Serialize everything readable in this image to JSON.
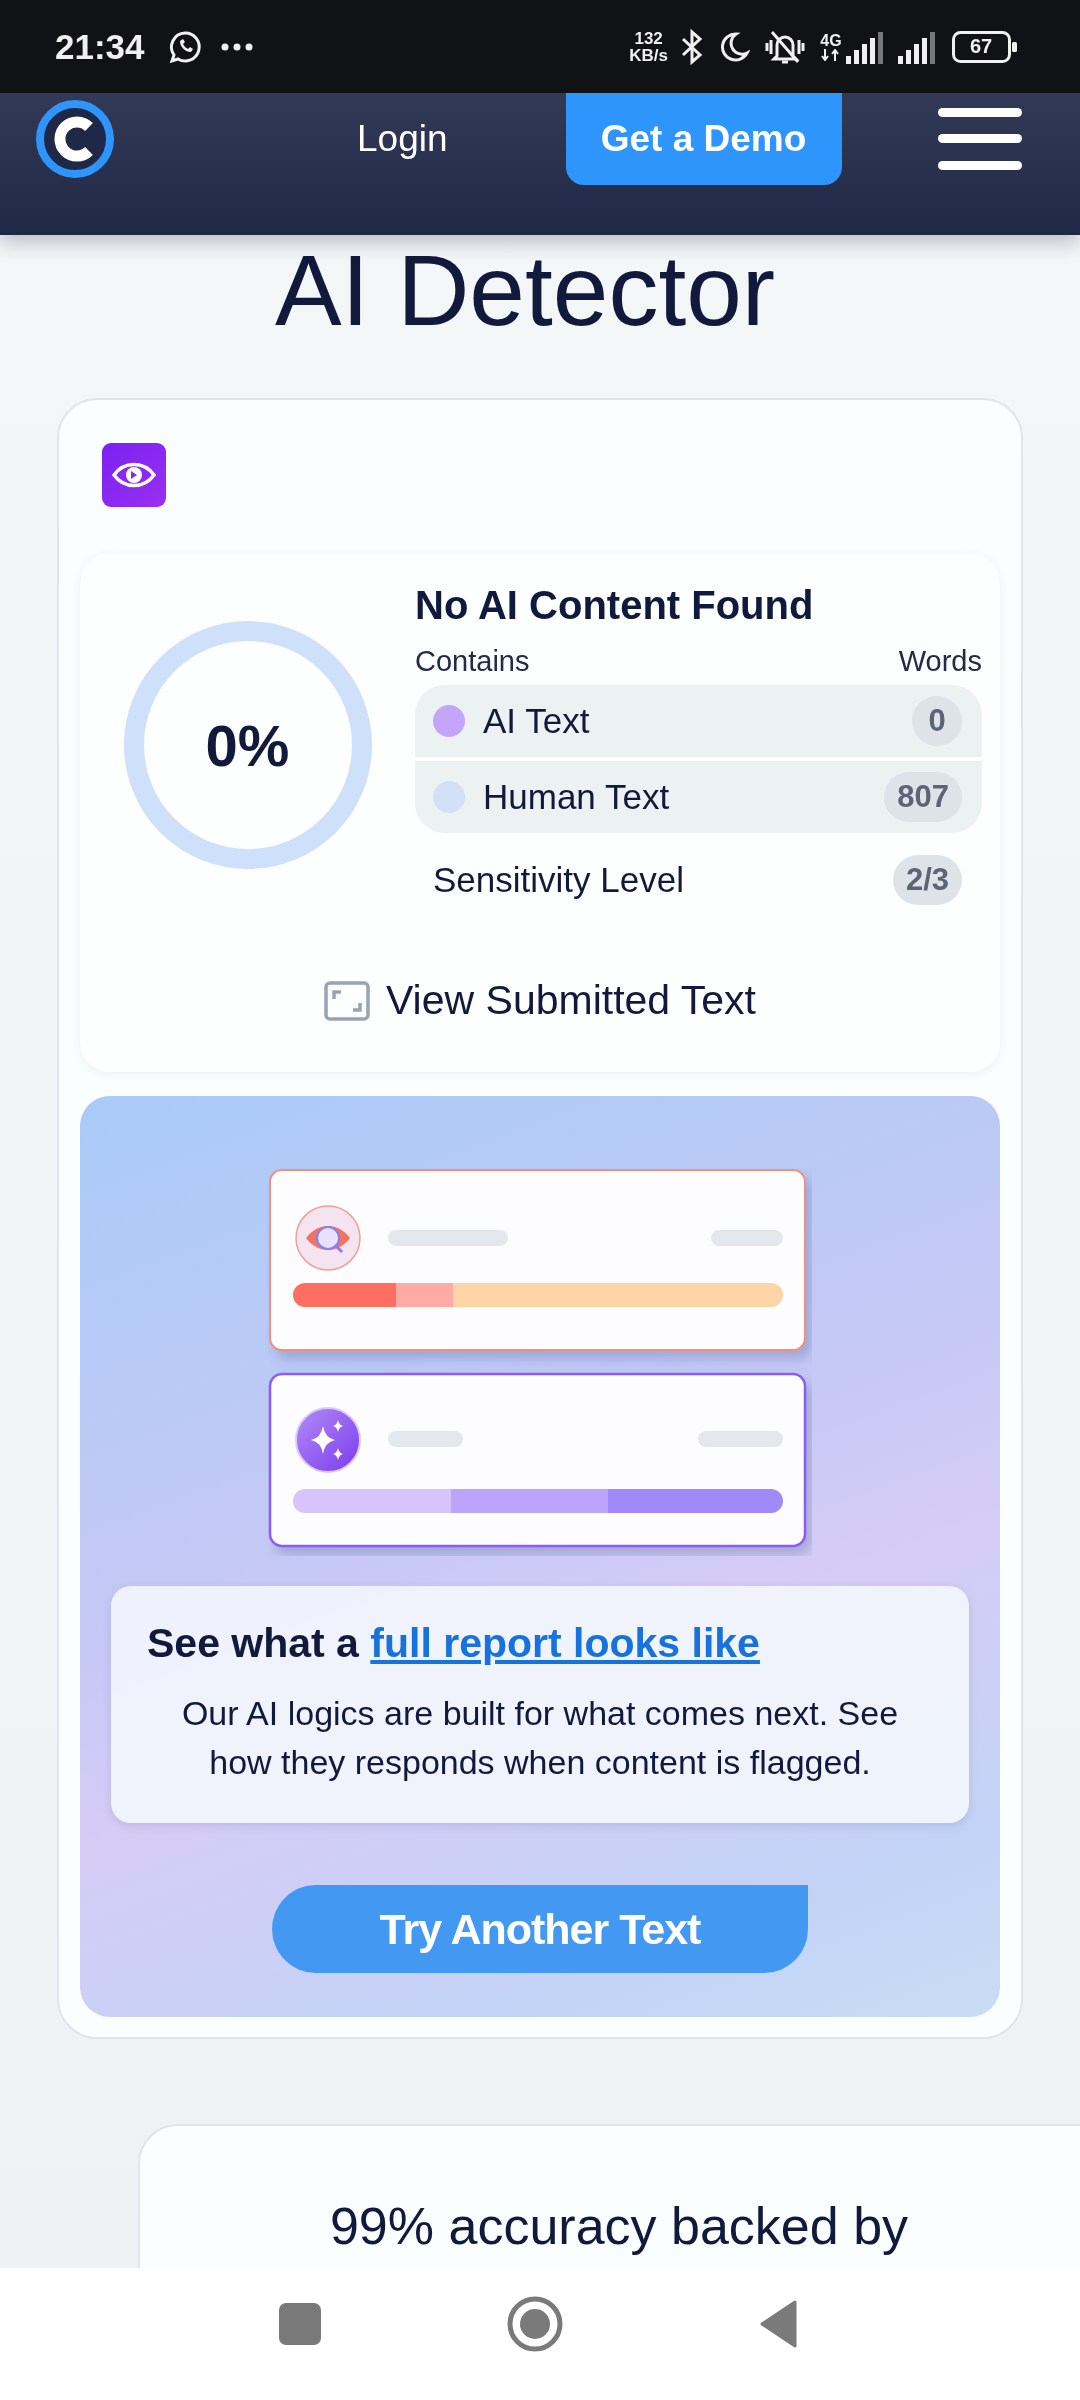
{
  "status_bar": {
    "time": "21:34",
    "net_speed_value": "132",
    "net_speed_unit": "KB/s",
    "network_type": "4G",
    "battery": "67"
  },
  "header": {
    "login": "Login",
    "cta": "Get a Demo"
  },
  "page_title": "AI Detector",
  "result": {
    "score": "0%",
    "title": "No AI Content Found",
    "contains_label": "Contains",
    "words_label": "Words",
    "rows": [
      {
        "label": "AI Text",
        "count": "0",
        "color": "#c3a6fa"
      },
      {
        "label": "Human Text",
        "count": "807",
        "color": "#d2e1f7"
      }
    ],
    "sensitivity": {
      "label": "Sensitivity Level",
      "value": "2/3"
    },
    "view_link": "View Submitted Text"
  },
  "promo": {
    "heading_prefix": "See what a ",
    "link": "full report looks like",
    "body": "Our AI logics are built for what comes next. See how they responds when content is flagged.",
    "button": "Try Another Text"
  },
  "next_card": {
    "heading": "99% accuracy backed by"
  }
}
